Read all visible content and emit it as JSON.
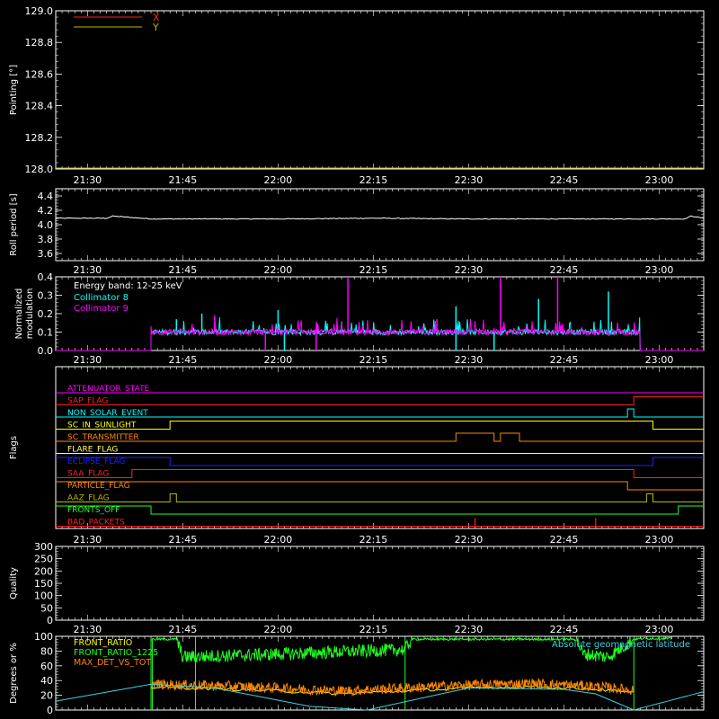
{
  "time_ticks": [
    "21:30",
    "21:45",
    "22:00",
    "22:15",
    "22:30",
    "22:45",
    "23:00"
  ],
  "time_range": [
    "21:25",
    "23:07"
  ],
  "chart_data": [
    {
      "id": "pointing",
      "type": "line",
      "ylabel": "Pointing [°]",
      "ylim": [
        128.0,
        129.0
      ],
      "yticks": [
        "128.0",
        "128.2",
        "128.4",
        "128.6",
        "128.8",
        "129.0"
      ],
      "legend_placement": "top-left",
      "series": [
        {
          "name": "X",
          "color": "#ff2020",
          "values": []
        },
        {
          "name": "Y",
          "color": "#b8b800",
          "values": []
        }
      ]
    },
    {
      "id": "roll",
      "type": "line",
      "ylabel": "Roll period [s]",
      "ylim": [
        3.5,
        4.5
      ],
      "yticks": [
        "3.6",
        "3.8",
        "4.0",
        "4.2",
        "4.4"
      ],
      "series": [
        {
          "color": "#ffffff",
          "x": [
            "21:25",
            "21:33",
            "21:34",
            "21:40",
            "22:00",
            "22:15",
            "22:30",
            "22:45",
            "23:00",
            "23:04",
            "23:05",
            "23:07"
          ],
          "values": [
            4.09,
            4.09,
            4.12,
            4.08,
            4.08,
            4.09,
            4.08,
            4.08,
            4.08,
            4.08,
            4.12,
            4.09
          ]
        }
      ]
    },
    {
      "id": "modulation",
      "type": "line",
      "ylabel": "Normalized modulation",
      "ylim": [
        0.0,
        0.4
      ],
      "yticks": [
        "0.0",
        "0.1",
        "0.2",
        "0.3",
        "0.4"
      ],
      "annotation": "Energy band: 12-25 keV",
      "active_range": [
        "21:40",
        "22:57"
      ],
      "baseline": 0.1,
      "series": [
        {
          "name": "Collimator 8",
          "color": "#00ffff",
          "spikes": [
            [
              "21:48",
              0.2
            ],
            [
              "22:00",
              0.22
            ],
            [
              "22:28",
              0.24
            ],
            [
              "22:41",
              0.28
            ],
            [
              "22:52",
              0.32
            ],
            [
              "21:44",
              0.17
            ]
          ],
          "dropouts": [
            [
              "22:01",
              0.0
            ],
            [
              "22:28",
              0.0
            ],
            [
              "22:34",
              0.0
            ]
          ]
        },
        {
          "name": "Collimator 9",
          "color": "#ff00ff",
          "spikes": [
            [
              "22:11",
              0.4
            ],
            [
              "22:35",
              0.4
            ],
            [
              "22:44",
              0.4
            ],
            [
              "21:50",
              0.19
            ],
            [
              "22:25",
              0.17
            ]
          ],
          "dropouts": [
            [
              "21:58",
              0.0
            ],
            [
              "22:06",
              0.0
            ]
          ]
        }
      ]
    },
    {
      "id": "flags",
      "type": "line",
      "ylabel": "Flags",
      "flags": [
        {
          "name": "ATTENUATOR_STATE",
          "color": "#ff00ff",
          "segments": [
            [
              "21:25",
              "23:07",
              0
            ]
          ]
        },
        {
          "name": "SAP_FLAG",
          "color": "#ff2020",
          "segments": [
            [
              "21:25",
              "22:56",
              0
            ],
            [
              "22:56",
              "23:07",
              1
            ]
          ]
        },
        {
          "name": "NON_SOLAR_EVENT",
          "color": "#00ffff",
          "segments": [
            [
              "21:25",
              "22:55",
              0
            ],
            [
              "22:55",
              "22:56",
              1
            ],
            [
              "22:56",
              "23:07",
              0
            ]
          ]
        },
        {
          "name": "SC_IN_SUNLIGHT",
          "color": "#ffff00",
          "segments": [
            [
              "21:25",
              "21:43",
              0
            ],
            [
              "21:43",
              "22:59",
              1
            ],
            [
              "22:59",
              "23:07",
              0
            ]
          ]
        },
        {
          "name": "SC_TRANSMITTER",
          "color": "#ff8800",
          "segments": [
            [
              "21:25",
              "22:28",
              0
            ],
            [
              "22:28",
              "22:34",
              1
            ],
            [
              "22:34",
              "22:35",
              0
            ],
            [
              "22:35",
              "22:38",
              1
            ],
            [
              "22:38",
              "23:07",
              0
            ]
          ]
        },
        {
          "name": "FLARE_FLAG",
          "color": "#ffff66",
          "segments": [
            [
              "21:25",
              "23:07",
              0
            ]
          ]
        },
        {
          "name": "ECLIPSE_FLAG",
          "color": "#2020ff",
          "segments": [
            [
              "21:25",
              "21:43",
              1
            ],
            [
              "21:43",
              "22:59",
              0
            ],
            [
              "22:59",
              "23:07",
              1
            ]
          ]
        },
        {
          "name": "SAA_FLAG",
          "color": "#ff2020",
          "segments": [
            [
              "21:25",
              "21:37",
              0
            ],
            [
              "21:37",
              "22:56",
              1
            ],
            [
              "22:56",
              "23:07",
              0
            ]
          ]
        },
        {
          "name": "PARTICLE_FLAG",
          "color": "#ff8800",
          "segments": [
            [
              "21:25",
              "22:55",
              1
            ],
            [
              "22:55",
              "23:07",
              0
            ]
          ]
        },
        {
          "name": "AAZ_FLAG",
          "color": "#b8b800",
          "segments": [
            [
              "21:25",
              "21:43",
              0
            ],
            [
              "21:43",
              "21:44",
              1
            ],
            [
              "21:44",
              "22:58",
              0
            ],
            [
              "22:58",
              "22:59",
              1
            ],
            [
              "22:59",
              "23:07",
              0
            ]
          ]
        },
        {
          "name": "FRONTS_OFF",
          "color": "#20ff20",
          "segments": [
            [
              "21:25",
              "21:40",
              1
            ],
            [
              "21:40",
              "23:03",
              0
            ],
            [
              "23:03",
              "23:07",
              1
            ]
          ]
        },
        {
          "name": "BAD_PACKETS",
          "color": "#ff2020",
          "segments": [
            [
              "21:25",
              "23:07",
              0
            ]
          ],
          "blips": [
            "22:31",
            "22:50"
          ]
        }
      ]
    },
    {
      "id": "quality",
      "type": "line",
      "ylabel": "Quality",
      "ylim": [
        0,
        300
      ],
      "yticks": [
        "0",
        "50",
        "100",
        "150",
        "200",
        "250",
        "300"
      ],
      "series": []
    },
    {
      "id": "ratios",
      "type": "line",
      "ylabel": "Degrees or %",
      "ylim": [
        0,
        100
      ],
      "yticks": [
        "0",
        "20",
        "40",
        "60",
        "80",
        "100"
      ],
      "series": [
        {
          "name": "FRONT_RATIO",
          "color": "#ffff00"
        },
        {
          "name": "FRONT_RATIO_1225",
          "color": "#20ff20",
          "x": [
            "21:40",
            "21:44",
            "21:45",
            "21:57",
            "22:20",
            "22:21",
            "22:47",
            "22:48",
            "22:52",
            "22:56",
            "22:57",
            "23:02"
          ],
          "values": [
            96,
            96,
            72,
            75,
            82,
            96,
            96,
            76,
            72,
            96,
            97,
            97
          ]
        },
        {
          "name": "MAX_DET_VS_TOT",
          "color": "#ff8800",
          "x": [
            "21:40",
            "21:50",
            "22:00",
            "22:10",
            "22:20",
            "22:30",
            "22:40",
            "22:50",
            "22:56"
          ],
          "values": [
            35,
            33,
            30,
            26,
            30,
            34,
            36,
            32,
            27
          ]
        },
        {
          "name": "Absolute geomagnetic latitude",
          "color": "#40d0e0",
          "x": [
            "21:25",
            "21:40",
            "21:50",
            "22:05",
            "22:14",
            "22:22",
            "22:30",
            "22:45",
            "22:50",
            "22:56",
            "23:07"
          ],
          "values": [
            12,
            35,
            30,
            5,
            0,
            15,
            30,
            28,
            22,
            0,
            25
          ]
        }
      ]
    }
  ]
}
